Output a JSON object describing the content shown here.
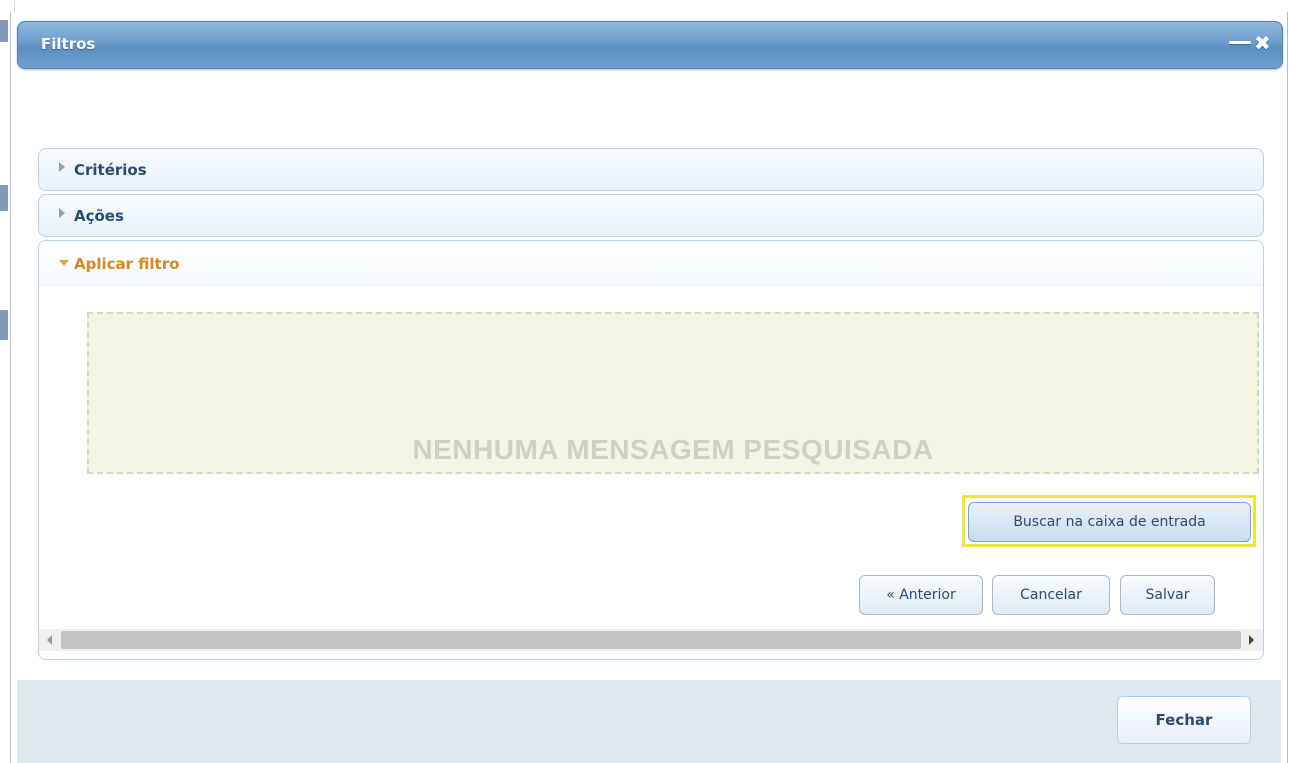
{
  "window": {
    "title": "Filtros",
    "minimize_symbol": "—",
    "close_symbol": "✖"
  },
  "sections": {
    "criteria": {
      "label": "Critérios",
      "expanded": false
    },
    "actions": {
      "label": "Ações",
      "expanded": false
    },
    "apply_filter": {
      "label": "Aplicar filtro",
      "expanded": true
    }
  },
  "results": {
    "empty_message": "NENHUMA MENSAGEM PESQUISADA"
  },
  "buttons": {
    "search_inbox": "Buscar na caixa de entrada",
    "previous": "« Anterior",
    "cancel": "Cancelar",
    "save": "Salvar",
    "close": "Fechar"
  },
  "colors": {
    "titlebar": "#6b9dcc",
    "open_section_label": "#d4891e",
    "highlight": "#f0e436",
    "empty_area": "#f5f5e4",
    "footer": "#dde9ec"
  }
}
